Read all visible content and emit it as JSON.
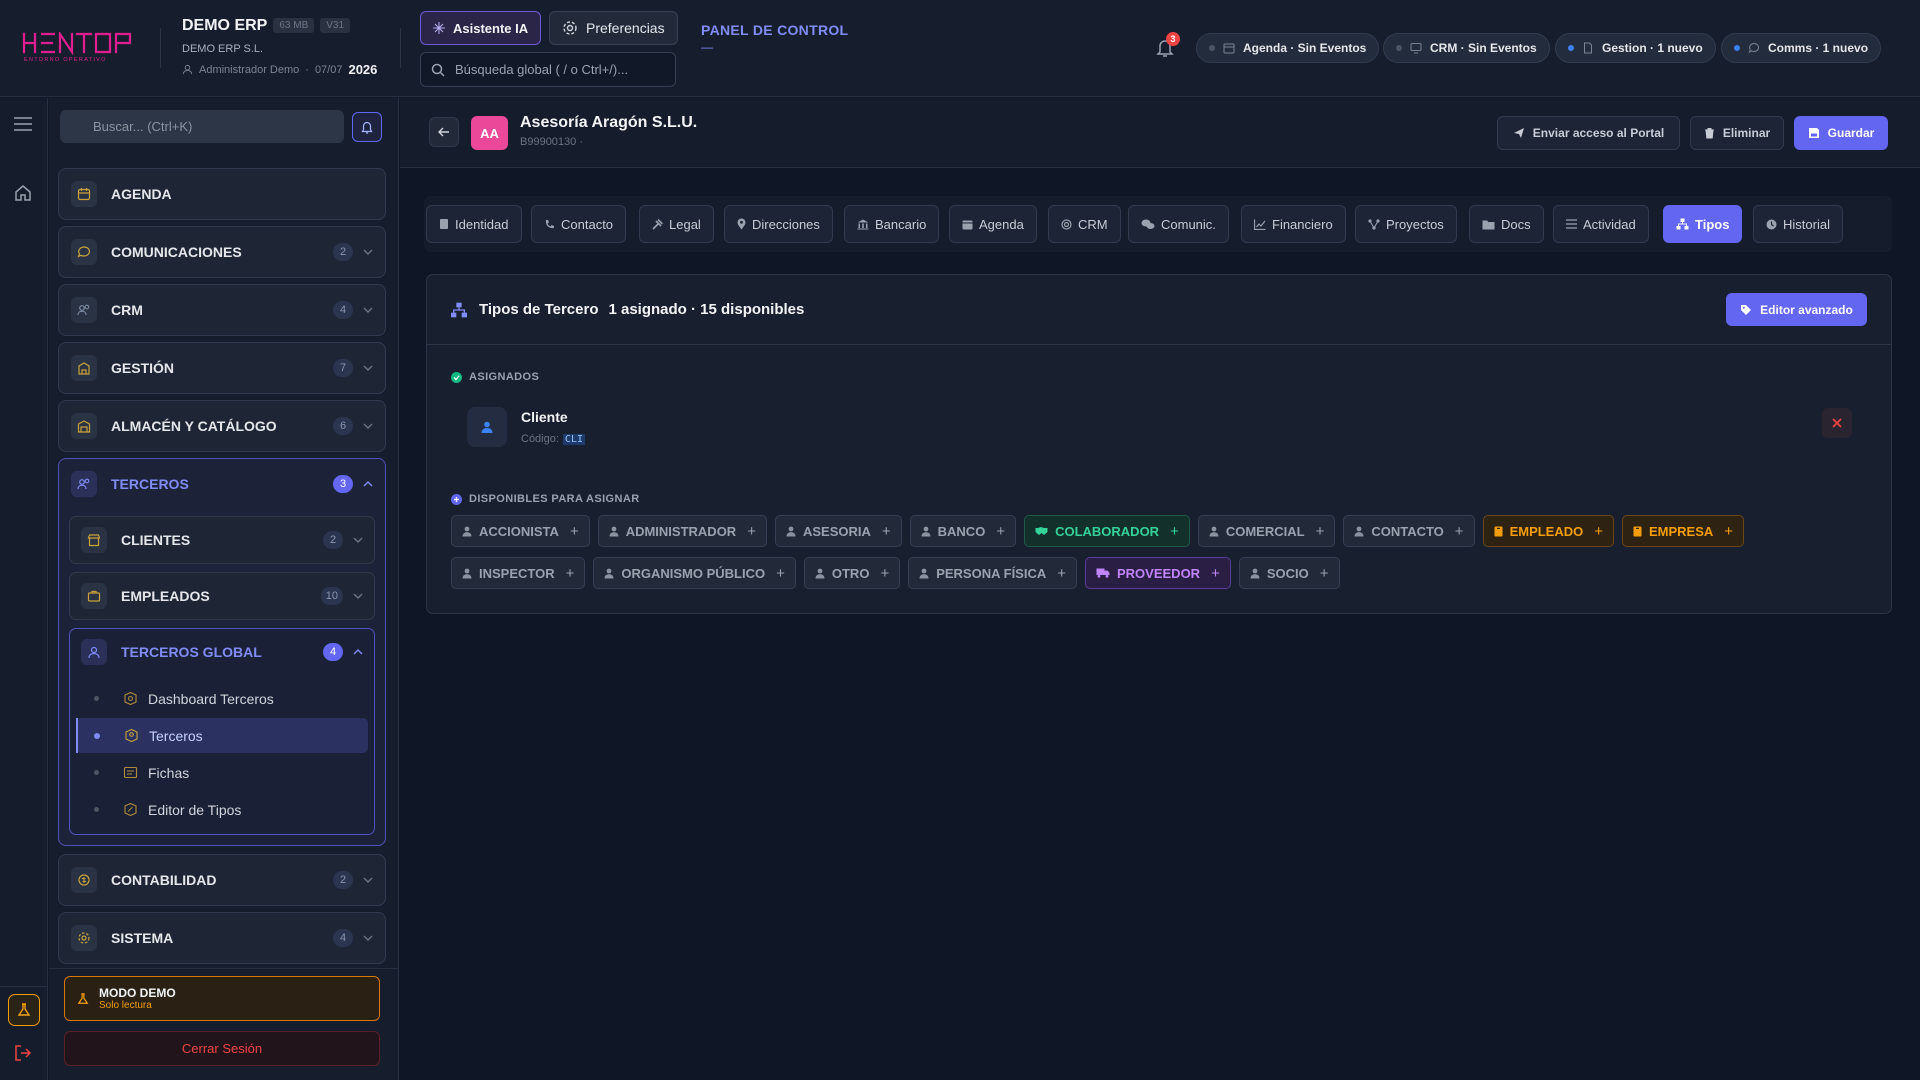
{
  "header": {
    "app_name": "DEMO ERP",
    "size_badge": "63 MB",
    "version_badge": "V31",
    "company": "DEMO ERP S.L.",
    "user": "Administrador Demo",
    "date": "07/07",
    "year": "2026",
    "ai_button": "Asistente IA",
    "prefs_button": "Preferencias",
    "search_placeholder": "Búsqueda global ( / o Ctrl+/)...",
    "panel_title": "PANEL DE CONTROL",
    "panel_sub": "—",
    "notif_count": "3",
    "status": [
      {
        "label": "Agenda · Sin Eventos",
        "icon": "calendar-icon",
        "dot": "#4b5563"
      },
      {
        "label": "CRM · Sin Eventos",
        "icon": "monitor-icon",
        "dot": "#4b5563"
      },
      {
        "label": "Gestion · 1 nuevo",
        "icon": "file-icon",
        "dot": "#3b82f6"
      },
      {
        "label": "Comms · 1 nuevo",
        "icon": "chat-icon",
        "dot": "#3b82f6"
      }
    ]
  },
  "sidebar": {
    "search_placeholder": "Buscar... (Ctrl+K)",
    "items": [
      {
        "label": "AGENDA"
      },
      {
        "label": "COMUNICACIONES",
        "count": "2"
      },
      {
        "label": "CRM",
        "count": "4"
      },
      {
        "label": "GESTIÓN",
        "count": "7"
      },
      {
        "label": "ALMACÉN Y CATÁLOGO",
        "count": "6"
      }
    ],
    "terceros": {
      "label": "TERCEROS",
      "count": "3",
      "clientes": {
        "label": "CLIENTES",
        "count": "2"
      },
      "empleados": {
        "label": "EMPLEADOS",
        "count": "10"
      },
      "global": {
        "label": "TERCEROS GLOBAL",
        "count": "4",
        "leaves": [
          "Dashboard Terceros",
          "Terceros",
          "Fichas",
          "Editor de Tipos"
        ]
      }
    },
    "contabilidad": {
      "label": "CONTABILIDAD",
      "count": "2"
    },
    "sistema": {
      "label": "SISTEMA",
      "count": "4"
    },
    "demo": {
      "title": "MODO DEMO",
      "subtitle": "Solo lectura"
    },
    "logout": "Cerrar Sesión"
  },
  "record": {
    "initials": "AA",
    "name": "Asesoría Aragón S.L.U.",
    "taxid": "B99900130 ·",
    "portal_button": "Enviar acceso al Portal",
    "delete_button": "Eliminar",
    "save_button": "Guardar"
  },
  "tabs": [
    {
      "label": "Identidad",
      "icon": "id-icon"
    },
    {
      "label": "Contacto",
      "icon": "phone-icon"
    },
    {
      "label": "Legal",
      "icon": "gavel-icon"
    },
    {
      "label": "Direcciones",
      "icon": "pin-icon"
    },
    {
      "label": "Bancario",
      "icon": "bank-icon"
    },
    {
      "label": "Agenda",
      "icon": "calendar-icon"
    },
    {
      "label": "CRM",
      "icon": "target-icon"
    },
    {
      "label": "Comunic.",
      "icon": "chat-icon"
    },
    {
      "label": "Financiero",
      "icon": "chart-icon"
    },
    {
      "label": "Proyectos",
      "icon": "nodes-icon"
    },
    {
      "label": "Docs",
      "icon": "folder-icon"
    },
    {
      "label": "Actividad",
      "icon": "list-icon"
    },
    {
      "label": "Tipos",
      "icon": "hierarchy-icon",
      "active": true
    },
    {
      "label": "Historial",
      "icon": "clock-icon"
    }
  ],
  "types_panel": {
    "title": "Tipos de Tercero",
    "summary": "1 asignado · 15 disponibles",
    "advanced_button": "Editor avanzado",
    "assigned_heading": "ASIGNADOS",
    "assigned": {
      "name": "Cliente",
      "code_label": "Código:",
      "code": "CLI"
    },
    "available_heading": "DISPONIBLES PARA ASIGNAR",
    "available_row1": [
      {
        "label": "ACCIONISTA",
        "tone": "gray"
      },
      {
        "label": "ADMINISTRADOR",
        "tone": "gray"
      },
      {
        "label": "ASESORIA",
        "tone": "gray"
      },
      {
        "label": "BANCO",
        "tone": "gray"
      },
      {
        "label": "COLABORADOR",
        "tone": "green"
      },
      {
        "label": "COMERCIAL",
        "tone": "gray"
      },
      {
        "label": "CONTACTO",
        "tone": "gray"
      },
      {
        "label": "EMPLEADO",
        "tone": "orange"
      },
      {
        "label": "EMPRESA",
        "tone": "orange"
      }
    ],
    "available_row2": [
      {
        "label": "INSPECTOR",
        "tone": "gray"
      },
      {
        "label": "ORGANISMO PÚBLICO",
        "tone": "gray"
      },
      {
        "label": "OTRO",
        "tone": "gray"
      },
      {
        "label": "PERSONA FÍSICA",
        "tone": "gray"
      },
      {
        "label": "PROVEEDOR",
        "tone": "purple"
      },
      {
        "label": "SOCIO",
        "tone": "gray"
      }
    ]
  },
  "colors": {
    "accent": "#6366f1",
    "brand": "#e11d8f",
    "warning": "#f59e0b",
    "danger": "#ef4444",
    "success": "#10b981"
  }
}
